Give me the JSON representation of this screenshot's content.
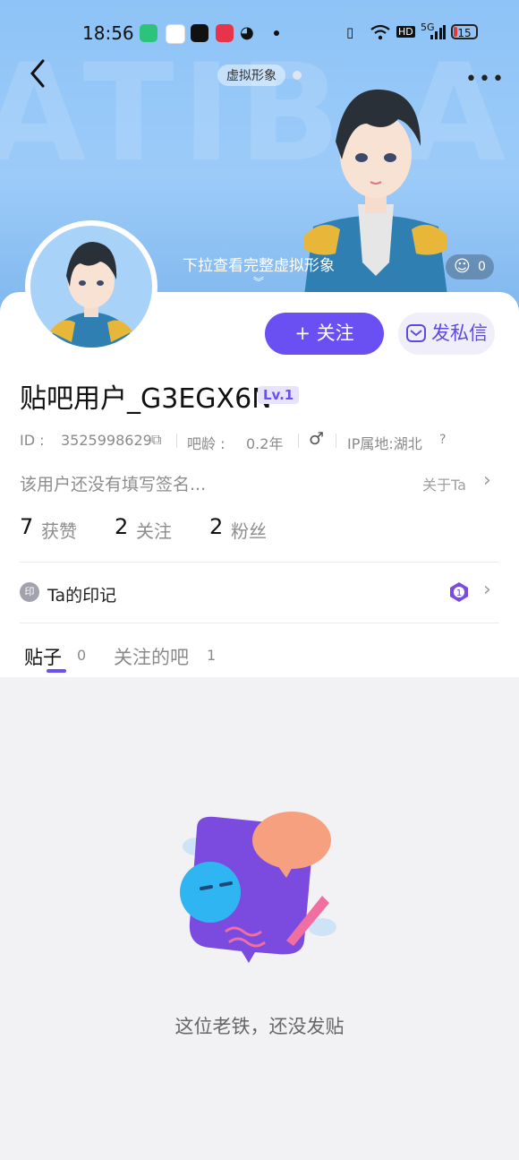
{
  "status_bar": {
    "time": "18:56",
    "battery": "15",
    "network": "5G",
    "hd": "HD"
  },
  "header": {
    "avatar_tag": "虚拟形象",
    "pull_hint": "下拉查看完整虚拟形象",
    "like_count": "0"
  },
  "actions": {
    "follow": "关注",
    "follow_plus": "+",
    "message": "发私信"
  },
  "profile": {
    "username": "贴吧用户_G3EGX6N",
    "level": "Lv.1",
    "id_label": "ID :",
    "id_value": "3525998629",
    "age_label": "吧龄 :",
    "age_value": "0.2年",
    "gender": "♂",
    "ip_location": "IP属地:湖北",
    "signature": "该用户还没有填写签名...",
    "about": "关于Ta"
  },
  "stats": [
    {
      "num": "7",
      "label": "获赞"
    },
    {
      "num": "2",
      "label": "关注"
    },
    {
      "num": "2",
      "label": "粉丝"
    }
  ],
  "imprint": {
    "icon": "印",
    "label": "Ta的印记",
    "badge": "1"
  },
  "tabs": [
    {
      "label": "贴子",
      "count": "0"
    },
    {
      "label": "关注的吧",
      "count": "1"
    }
  ],
  "empty_state": {
    "text": "这位老铁，还没发贴"
  },
  "colors": {
    "accent": "#6a4ff2",
    "hero_bg": "#8ec3f7"
  }
}
